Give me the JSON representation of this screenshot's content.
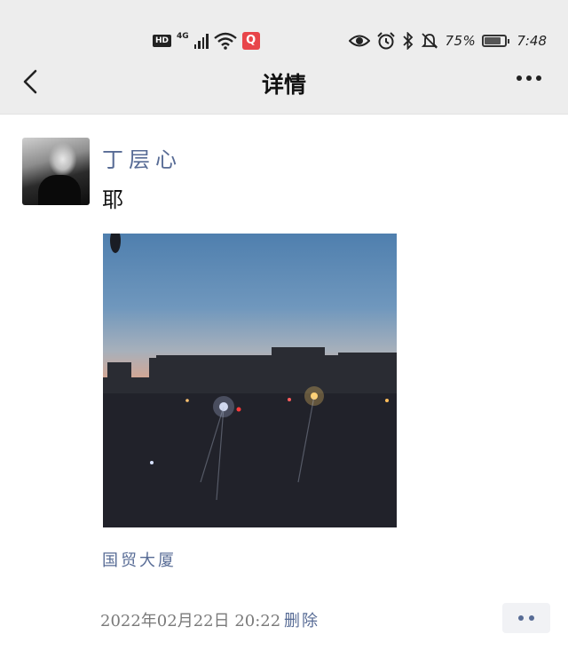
{
  "status_bar": {
    "hd_label": "HD",
    "network_label": "4G",
    "qq_label": "Q",
    "battery_percent": "75%",
    "battery_level": 0.75,
    "time": "7:48"
  },
  "nav": {
    "title": "详情",
    "back_icon": "chevron-left-icon",
    "more_icon": "more-dots-icon"
  },
  "post": {
    "username": "丁层心",
    "text": "耶",
    "photo": "sunset-city-skyline-photo",
    "location": "国贸大厦",
    "timestamp": "2022年02月22日  20:22",
    "delete_label": "删除",
    "comment_icon": "comment-dots-icon"
  },
  "colors": {
    "link": "#576b95",
    "header_bg": "#ededed"
  }
}
